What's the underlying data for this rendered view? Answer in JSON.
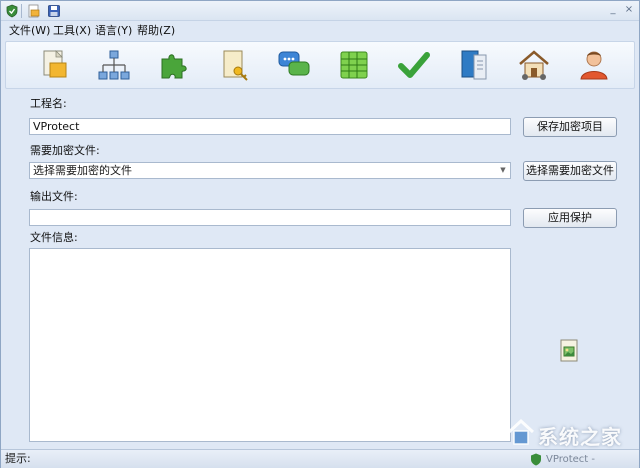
{
  "titlebar": {
    "icons": [
      "shield-icon",
      "open-folder-icon",
      "save-disk-icon"
    ],
    "controls": [
      "_",
      "×"
    ]
  },
  "menu": [
    {
      "label": "文件(W)"
    },
    {
      "label": "工具(X)"
    },
    {
      "label": "语言(Y)"
    },
    {
      "label": "帮助(Z)"
    }
  ],
  "toolbar": {
    "buttons": [
      "new-file-icon",
      "sitemap-icon",
      "puzzle-icon",
      "key-document-icon",
      "chat-bubble-icon",
      "spreadsheet-icon",
      "checkmark-icon",
      "book-icon",
      "home-icon",
      "user-icon"
    ]
  },
  "form": {
    "project_name_label": "工程名:",
    "project_name_value": "VProtect",
    "save_project_button": "保存加密项目",
    "files_label": "需要加密文件:",
    "files_selected": "选择需要加密的文件",
    "select_files_button": "选择需要加密文件",
    "output_label": "输出文件:",
    "output_value": "",
    "apply_button": "应用保护",
    "info_label": "文件信息:"
  },
  "status": {
    "label": "提示:",
    "brand": "VProtect - StrongProtect"
  },
  "watermark": {
    "text": "系统之家"
  },
  "colors": {
    "accent": "#3f7fd0",
    "toolbar_bg": "#e9f0fa",
    "window_bg": "#dfe8f5"
  }
}
